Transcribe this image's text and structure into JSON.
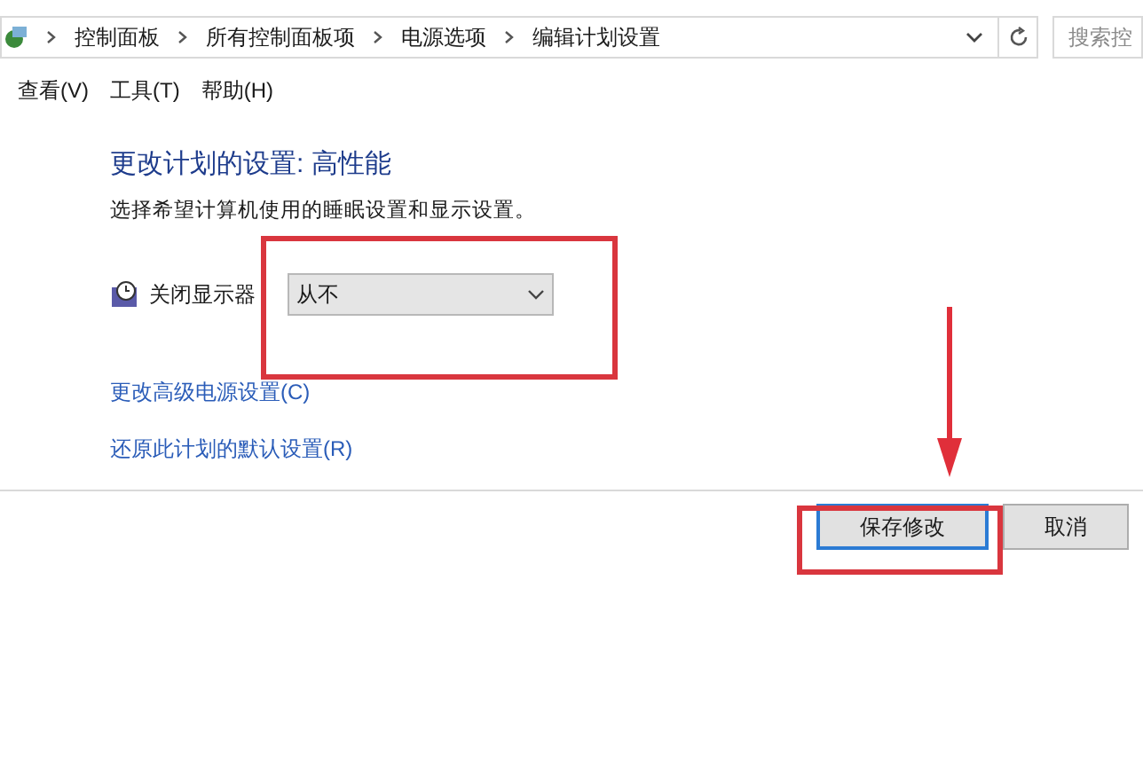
{
  "address_bar": {
    "breadcrumbs": [
      "控制面板",
      "所有控制面板项",
      "电源选项",
      "编辑计划设置"
    ]
  },
  "search": {
    "placeholder": "搜索控"
  },
  "menu": [
    "查看(V)",
    "工具(T)",
    "帮助(H)"
  ],
  "heading": "更改计划的设置: 高性能",
  "description": "选择希望计算机使用的睡眠设置和显示设置。",
  "settings": [
    {
      "label": "关闭显示器",
      "value": "从不"
    }
  ],
  "links": [
    "更改高级电源设置(C)",
    "还原此计划的默认设置(R)"
  ],
  "buttons": [
    {
      "label": "保存修改",
      "selected": true
    },
    {
      "label": "取消",
      "selected": false
    }
  ]
}
